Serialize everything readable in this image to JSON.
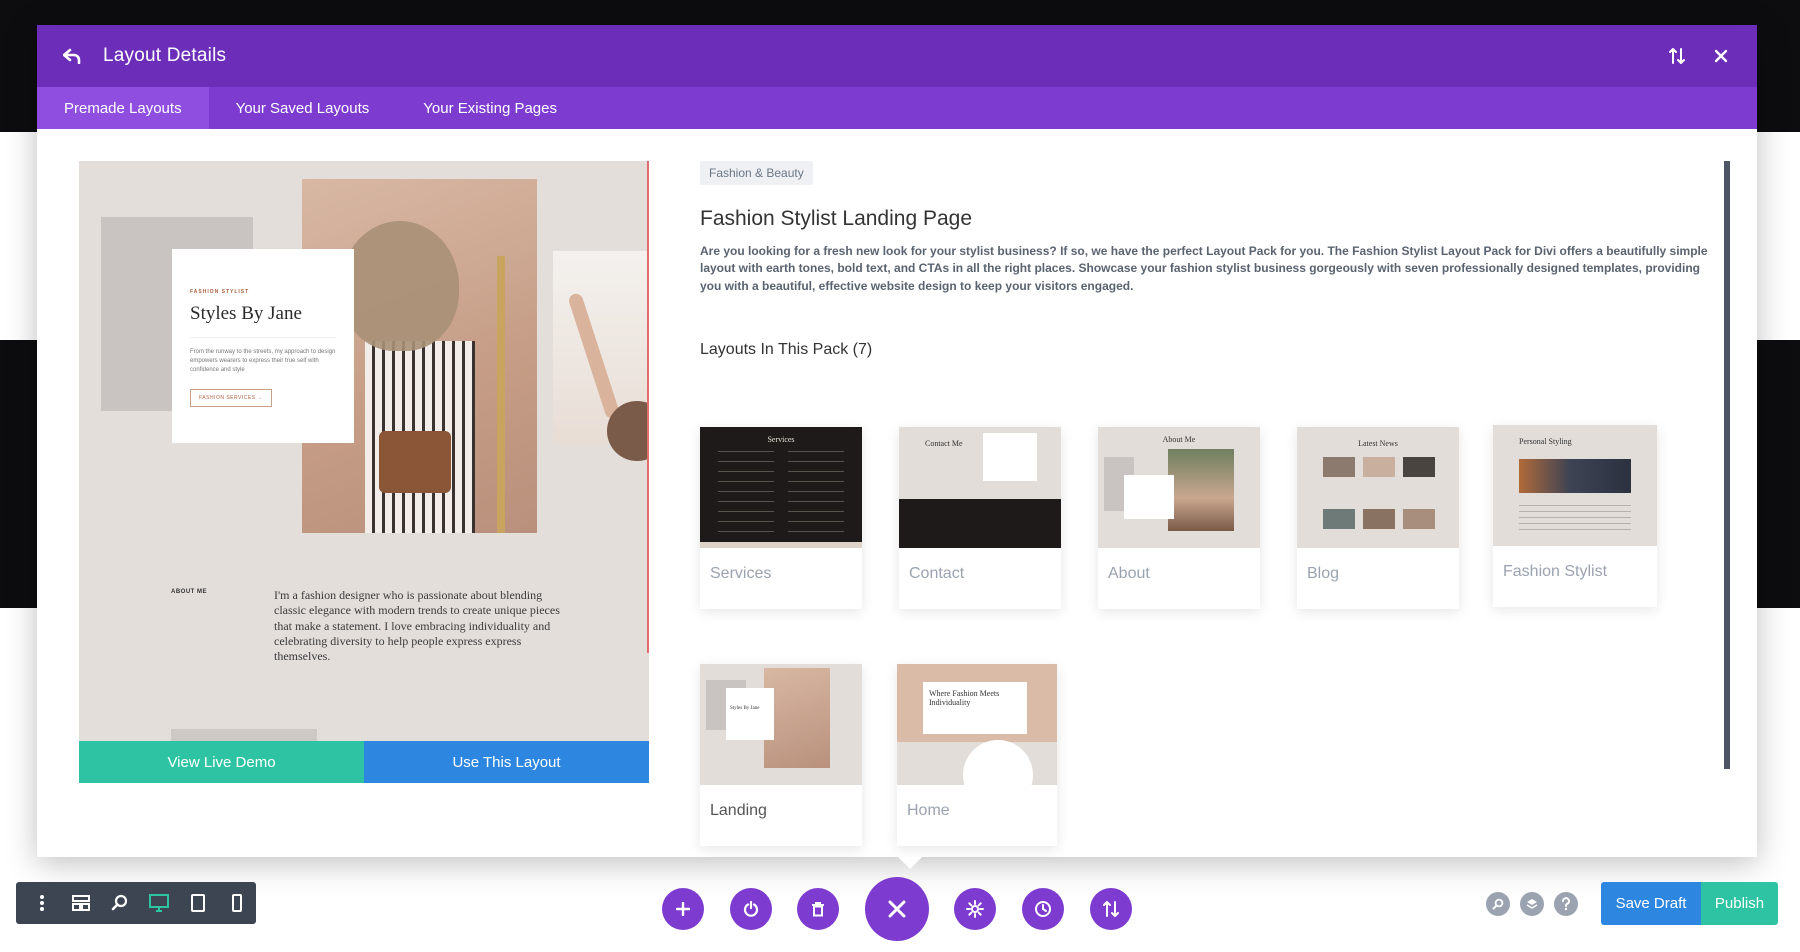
{
  "modal": {
    "title": "Layout Details",
    "tabs": [
      {
        "label": "Premade Layouts",
        "active": true
      },
      {
        "label": "Your Saved Layouts",
        "active": false
      },
      {
        "label": "Your Existing Pages",
        "active": false
      }
    ]
  },
  "preview": {
    "eyebrow": "FASHION STYLIST",
    "heading": "Styles By Jane",
    "blurb": "From the runway to the streets, my approach to design empowers wearers to express their true self with confidence and style",
    "cta": "FASHION SERVICES →",
    "about_label": "ABOUT ME",
    "about_text": "I'm a fashion designer who is passionate about blending classic elegance with modern trends to create unique pieces that make a statement. I love embracing individuality and celebrating diversity to help people express express themselves.",
    "view_demo_label": "View Live Demo",
    "use_layout_label": "Use This Layout"
  },
  "detail": {
    "category": "Fashion & Beauty",
    "title": "Fashion Stylist Landing Page",
    "description": "Are you looking for a fresh new look for your stylist business? If so, we have the perfect Layout Pack for you. The Fashion Stylist Layout Pack for Divi offers a beautifully simple layout with earth tones, bold text, and CTAs in all the right places. Showcase your fashion stylist business gorgeously with seven professionally designed templates, providing you with a beautiful, effective website design to keep your visitors engaged.",
    "pack_heading": "Layouts In This Pack (7)",
    "layouts": [
      {
        "label": "Services",
        "thumb_title": "Services"
      },
      {
        "label": "Contact",
        "thumb_title": "Contact Me"
      },
      {
        "label": "About",
        "thumb_title": "About Me"
      },
      {
        "label": "Blog",
        "thumb_title": "Latest News"
      },
      {
        "label": "Fashion Stylist",
        "thumb_title": "Personal Styling"
      },
      {
        "label": "Landing",
        "thumb_title": "Styles By Jane"
      },
      {
        "label": "Home",
        "thumb_title": "Where Fashion Meets Individuality"
      }
    ]
  },
  "bottom_bar": {
    "save_draft_label": "Save Draft",
    "publish_label": "Publish"
  },
  "colors": {
    "header": "#6c2eb9",
    "tabs": "#7e3bd0",
    "demo_button": "#2ec4a3",
    "use_button": "#2d86e0"
  }
}
